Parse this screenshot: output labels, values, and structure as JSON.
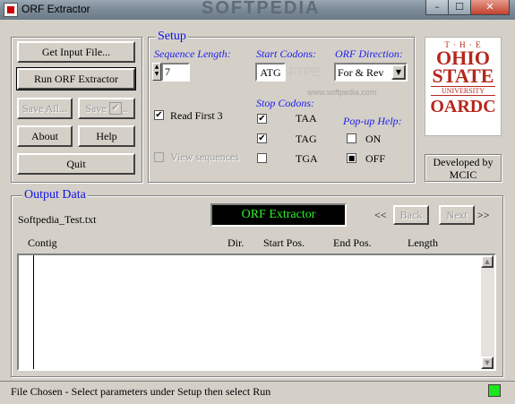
{
  "window": {
    "title": "ORF Extractor",
    "watermark": "SOFTPEDIA"
  },
  "buttons": {
    "get_input": "Get Input File...",
    "run": "Run ORF Extractor",
    "save_all": "Save All...",
    "save_sel": "Save",
    "about": "About",
    "help": "Help",
    "quit": "Quit"
  },
  "setup": {
    "title": "Setup",
    "seq_len_label": "Sequence Length:",
    "seq_len_value": "7",
    "start_codons_label": "Start Codons:",
    "start_codon_value": "ATG",
    "orf_dir_label": "ORF Direction:",
    "orf_dir_value": "For & Rev",
    "read_first_label": "Read First 3",
    "read_first_checked": "✔",
    "view_seq_label": "View sequences",
    "stop_codons_label": "Stop Codons:",
    "stop_codons": [
      {
        "label": "TAA",
        "mark": "✔"
      },
      {
        "label": "TAG",
        "mark": "✔"
      },
      {
        "label": "TGA",
        "mark": ""
      }
    ],
    "popup_help_label": "Pop-up Help:",
    "popup_on": "ON",
    "popup_off": "OFF",
    "popup_off_mark": "■"
  },
  "logo": {
    "the": "T · H · E",
    "ohio": "OHIO",
    "state": "STATE",
    "university": "UNIVERSITY",
    "oardc": "OARDC"
  },
  "credit": {
    "line1": "Developed by",
    "line2": "MCIC"
  },
  "output": {
    "title": "Output Data",
    "filename": "Softpedia_Test.txt",
    "display": "ORF Extractor",
    "prev_nav": "<<",
    "back": "Back",
    "next": "Next",
    "next_nav": ">>",
    "columns": [
      "Contig",
      "Dir.",
      "Start Pos.",
      "End Pos.",
      "Length"
    ]
  },
  "watermark2": "www.softpedia.com",
  "status": {
    "text": "File Chosen - Select parameters under Setup then select Run",
    "indicator_color": "#1ee61e"
  }
}
